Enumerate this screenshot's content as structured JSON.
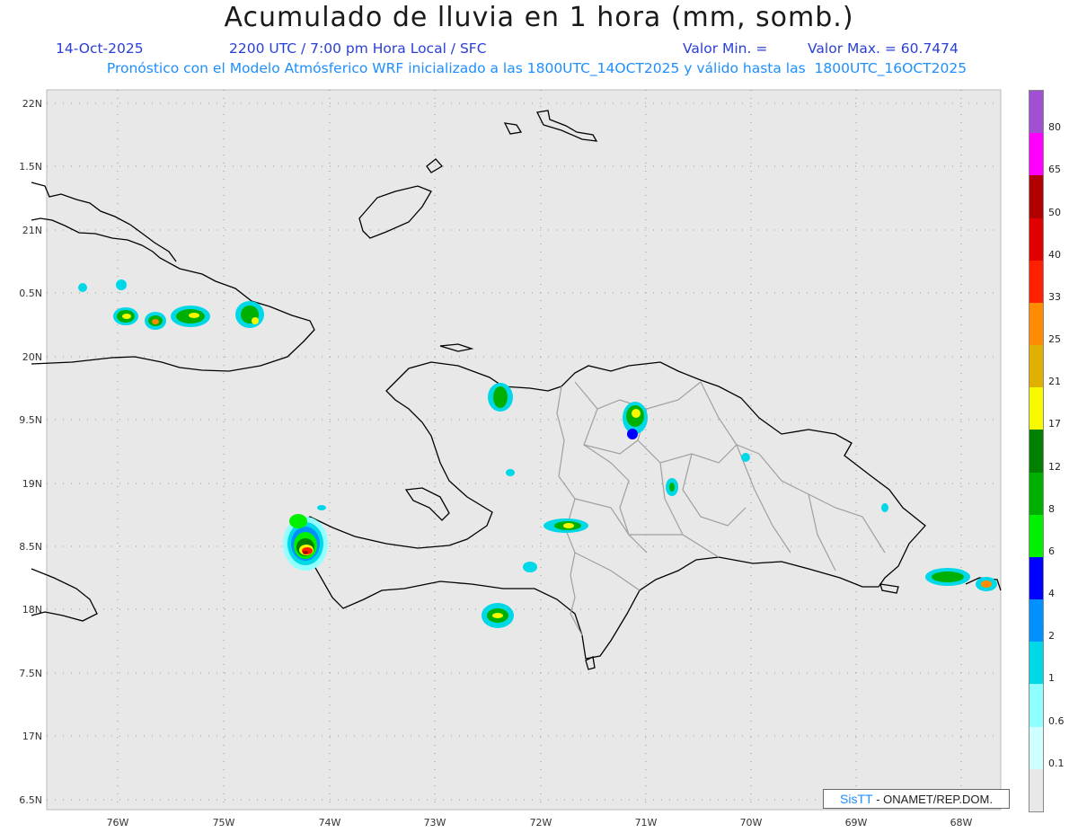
{
  "header": {
    "title": "Acumulado de lluvia en 1 hora (mm, somb.)",
    "date": "14-Oct-2025",
    "time": "2200 UTC / 7:00 pm Hora Local / SFC",
    "min_label": "Valor Min. =",
    "max_label": "Valor Max. = 60.7474",
    "model_line": "Pronóstico con el Modelo Atmósferico WRF inicializado a las 1800UTC_14OCT2025 y válido hasta las  1800UTC_16OCT2025"
  },
  "map": {
    "lat_labels": [
      "22N",
      "1.5N",
      "21N",
      "0.5N",
      "20N",
      "9.5N",
      "19N",
      "8.5N",
      "18N",
      "7.5N",
      "17N",
      "6.5N"
    ],
    "lon_labels": [
      "76W",
      "75W",
      "74W",
      "73W",
      "72W",
      "71W",
      "70W",
      "69W",
      "68W"
    ],
    "background_color": "#e8e8e8",
    "coast_color": "#000000",
    "province_color": "#a0a0a0"
  },
  "colorbar": {
    "labels": [
      "80",
      "65",
      "50",
      "40",
      "33",
      "25",
      "21",
      "17",
      "12",
      "8",
      "6",
      "4",
      "2",
      "1",
      "0.6",
      "0.1"
    ],
    "colors": [
      "#a050d0",
      "#ff00ff",
      "#b00000",
      "#e00000",
      "#ff2000",
      "#ff8c00",
      "#e0b000",
      "#f8f800",
      "#008000",
      "#00b000",
      "#00f000",
      "#0000ff",
      "#0090ff",
      "#00d8e8",
      "#90ffff",
      "#d0ffff",
      "#e8e8e8"
    ]
  },
  "credit": {
    "logo": "SisTT",
    "text": "- ONAMET/REP.DOM."
  }
}
